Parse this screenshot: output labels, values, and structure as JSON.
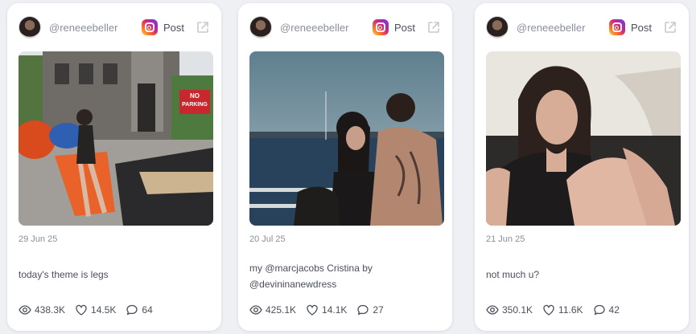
{
  "posts": [
    {
      "username": "@reneeebeller",
      "post_label": "Post",
      "date": "29 Jun 25",
      "caption": "today's theme is legs",
      "views": "438.3K",
      "likes": "14.5K",
      "comments": "64",
      "photo_description": "street-photo",
      "sign_text": [
        "NO",
        "PARKING"
      ]
    },
    {
      "username": "@reneeebeller",
      "post_label": "Post",
      "date": "20 Jul 25",
      "caption": "my @marcjacobs Cristina by @devininanewdress",
      "views": "425.1K",
      "likes": "14.1K",
      "comments": "27",
      "photo_description": "harbor-photo"
    },
    {
      "username": "@reneeebeller",
      "post_label": "Post",
      "date": "21 Jun 25",
      "caption": "not much u?",
      "views": "350.1K",
      "likes": "11.6K",
      "comments": "42",
      "photo_description": "portrait-photo"
    }
  ],
  "icons": {
    "platform": "instagram-icon",
    "open": "external-link-icon",
    "views": "eye-icon",
    "likes": "heart-icon",
    "comments": "comment-icon"
  },
  "colors": {
    "background": "#eef0f4",
    "card": "#ffffff",
    "muted_text": "#8a8f9c",
    "body_text": "#4a4f5c"
  }
}
